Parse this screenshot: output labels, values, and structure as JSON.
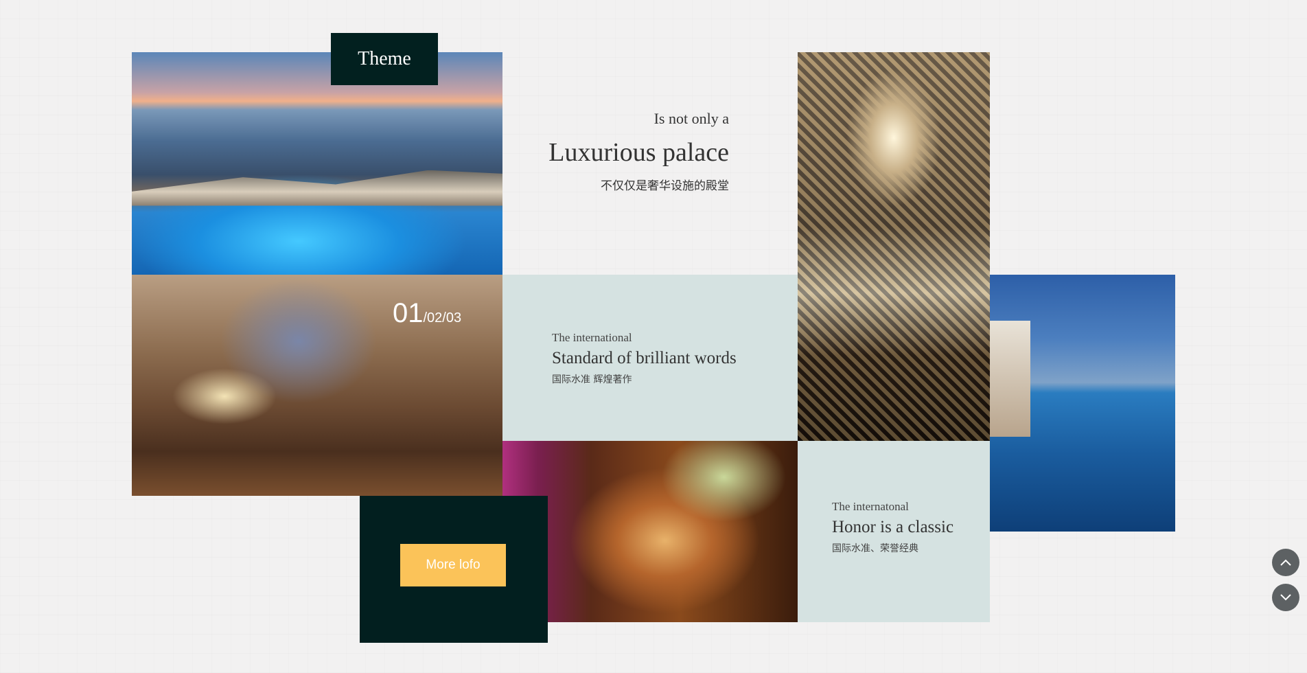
{
  "theme": {
    "label": "Theme"
  },
  "intro": {
    "eyebrow": "Is not only a",
    "title": "Luxurious palace",
    "subtitle": "不仅仅是奢华设施的殿堂"
  },
  "slider": {
    "current": "01",
    "rest": "/02/03"
  },
  "card1": {
    "eyebrow": "The international",
    "title": "Standard of brilliant words",
    "subtitle": "国际水准 辉煌著作"
  },
  "card2": {
    "eyebrow": "The internatonal",
    "title": "Honor is a classic",
    "subtitle": "国际水准、荣誉经典"
  },
  "cta": {
    "label": "More lofo"
  },
  "colors": {
    "dark": "#02201f",
    "panel": "#d5e2e1",
    "accent": "#fbc359",
    "nav": "#5d6163"
  },
  "icons": {
    "scroll_up": "chevron-up-icon",
    "scroll_down": "chevron-down-icon"
  }
}
